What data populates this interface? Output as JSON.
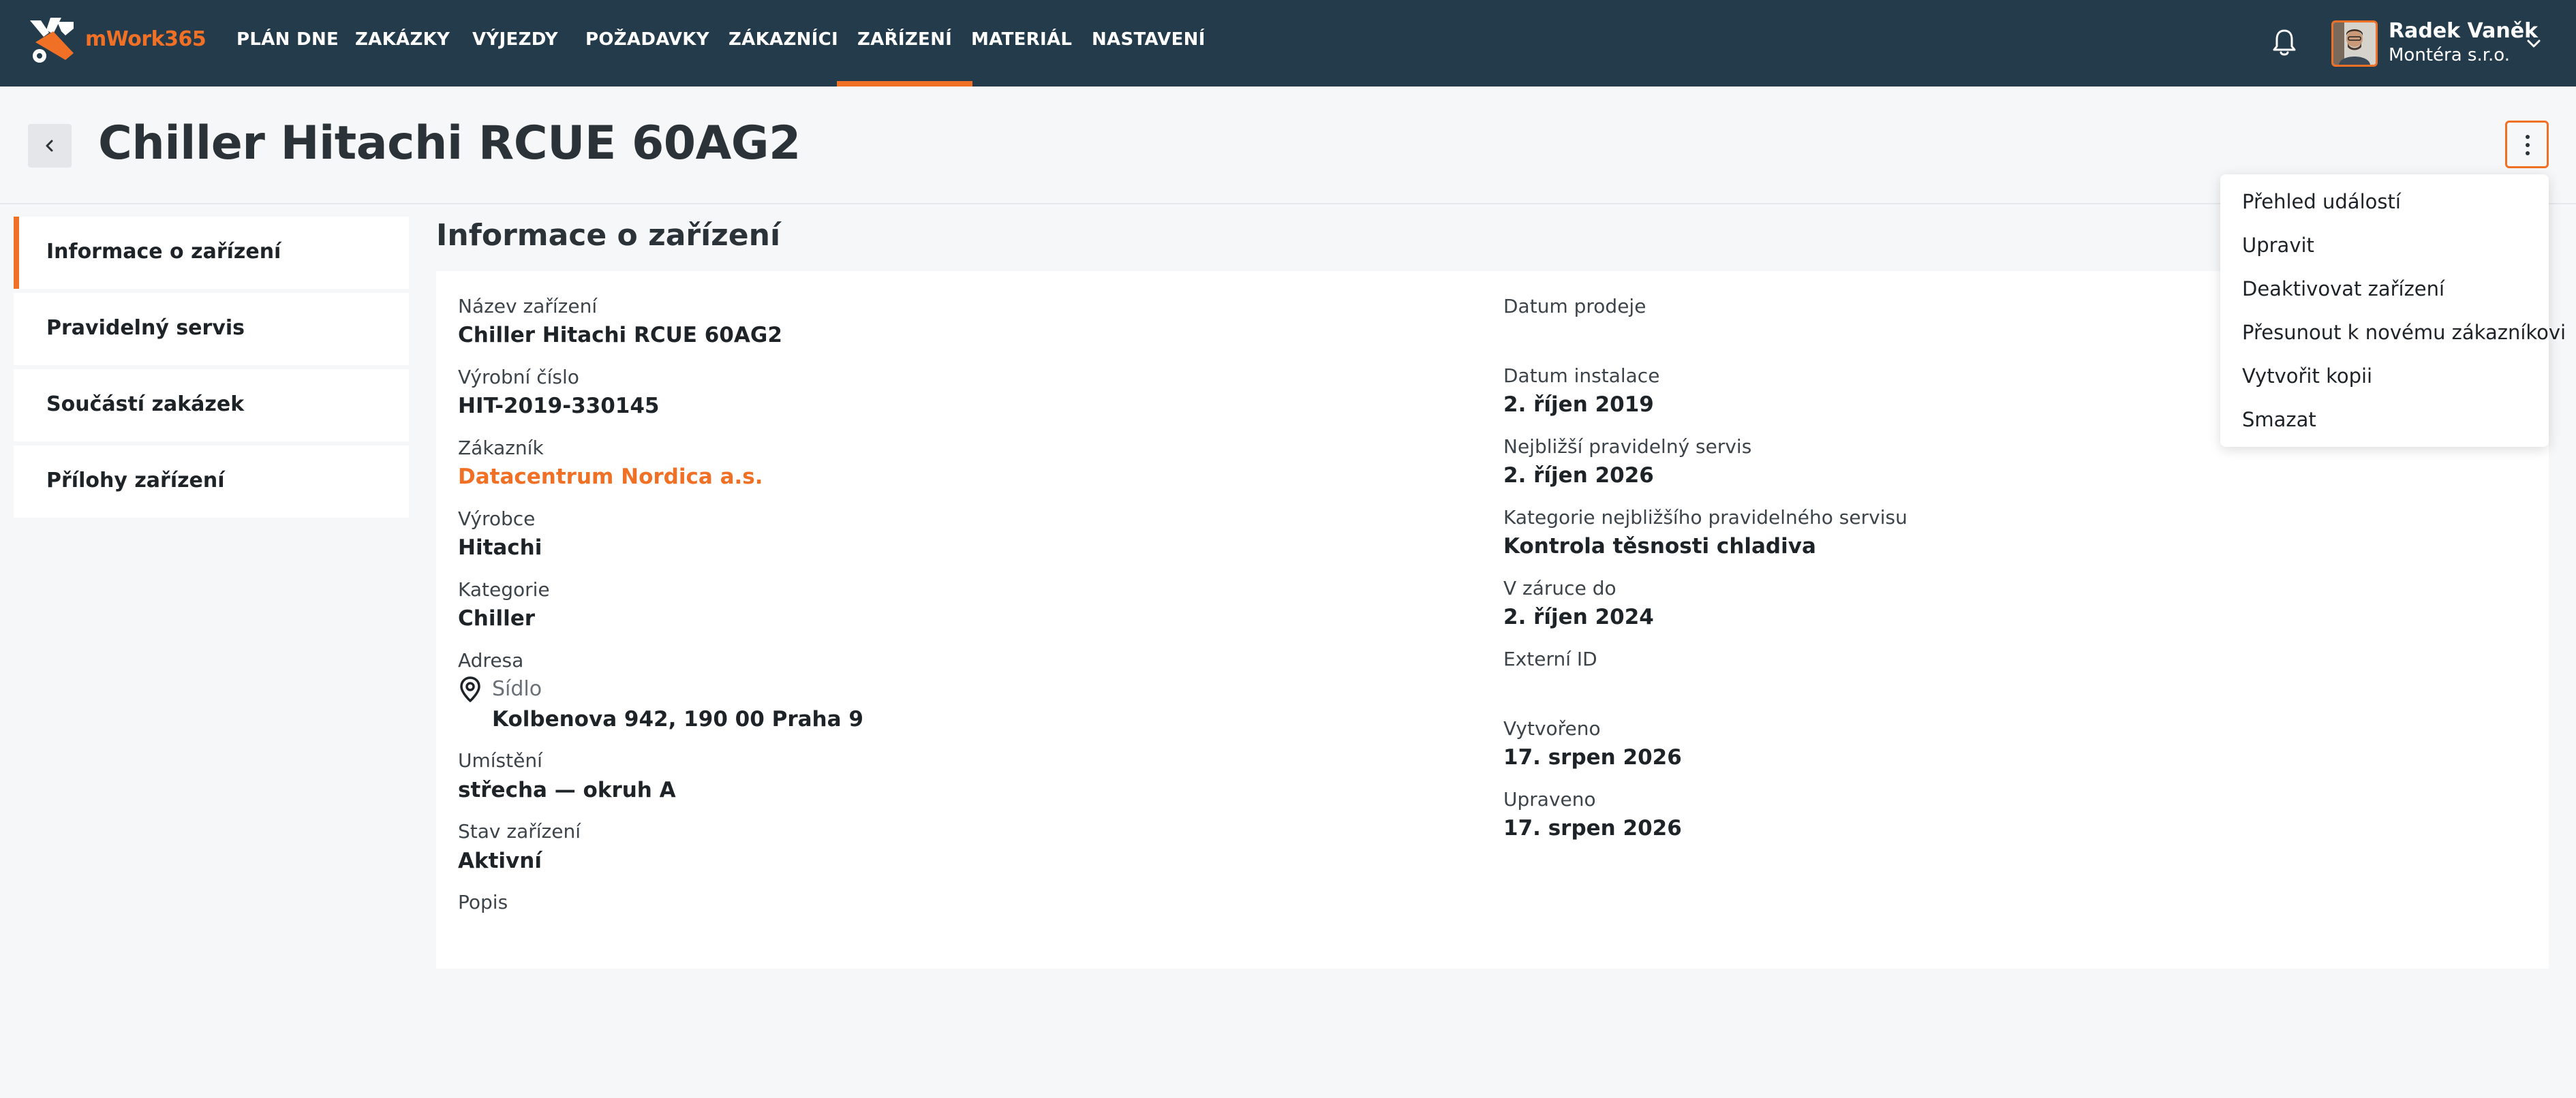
{
  "app": {
    "name": "mWork365",
    "brand_color": "#f07126",
    "nav_color": "#243b4b"
  },
  "nav": {
    "items": [
      {
        "label": "PLÁN DNE"
      },
      {
        "label": "ZAKÁZKY"
      },
      {
        "label": "VÝJEZDY"
      },
      {
        "label": "POŽADAVKY"
      },
      {
        "label": "ZÁKAZNÍCI"
      },
      {
        "label": "ZAŘÍZENÍ",
        "active": true
      },
      {
        "label": "MATERIÁL"
      },
      {
        "label": "NASTAVENÍ"
      }
    ]
  },
  "user": {
    "name": "Radek Vaněk",
    "company": "Montéra s.r.o."
  },
  "page": {
    "title": "Chiller Hitachi RCUE 60AG2"
  },
  "sidebar": {
    "items": [
      {
        "label": "Informace o zařízení",
        "active": true
      },
      {
        "label": "Pravidelný servis"
      },
      {
        "label": "Součástí zakázek"
      },
      {
        "label": "Přílohy zařízení"
      }
    ]
  },
  "section": {
    "title": "Informace o zařízení"
  },
  "details": {
    "left": [
      {
        "label": "Název zařízení",
        "value": "Chiller Hitachi RCUE 60AG2"
      },
      {
        "label": "Výrobní číslo",
        "value": "HIT-2019-330145"
      },
      {
        "label": "Zákazník",
        "value": "Datacentrum Nordica a.s."
      },
      {
        "label": "Výrobce",
        "value": "Hitachi"
      },
      {
        "label": "Kategorie",
        "value": "Chiller"
      },
      {
        "label": "Adresa",
        "sub_label": "Sídlo",
        "value": "Kolbenova 942, 190 00 Praha 9"
      },
      {
        "label": "Umístění",
        "value": "střecha — okruh A"
      },
      {
        "label": "Stav zařízení",
        "value": "Aktivní"
      },
      {
        "label": "Popis",
        "value": ""
      }
    ],
    "right": [
      {
        "label": "Datum prodeje",
        "value": ""
      },
      {
        "label": "Datum instalace",
        "value": "2. říjen 2019"
      },
      {
        "label": "Nejbližší pravidelný servis",
        "value": "2. říjen 2026"
      },
      {
        "label": "Kategorie nejbližšího pravidelného servisu",
        "value": "Kontrola těsnosti chladiva"
      },
      {
        "label": "V záruce do",
        "value": "2. říjen 2024"
      },
      {
        "label": "Externí ID",
        "value": ""
      },
      {
        "label": "Vytvořeno",
        "value": "17. srpen 2026"
      },
      {
        "label": "Upraveno",
        "value": "17. srpen 2026"
      }
    ]
  },
  "menu": {
    "items": [
      {
        "label": "Přehled událostí"
      },
      {
        "label": "Upravit"
      },
      {
        "label": "Deaktivovat zařízení"
      },
      {
        "label": "Přesunout k novému zákazníkovi"
      },
      {
        "label": "Vytvořit kopii"
      },
      {
        "label": "Smazat"
      }
    ]
  }
}
